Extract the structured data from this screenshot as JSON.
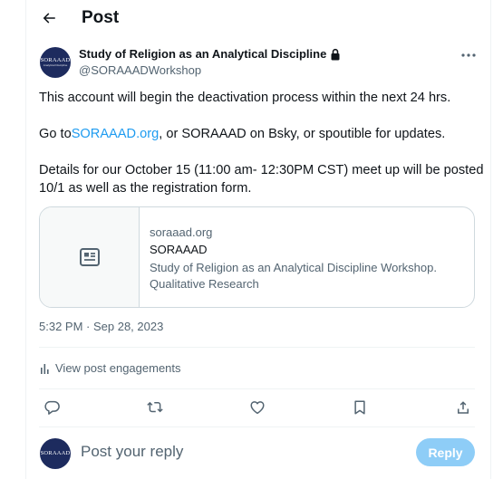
{
  "header": {
    "title": "Post"
  },
  "post": {
    "author_name": "Study of Religion as an Analytical Discipline",
    "author_handle": "@SORAAADWorkshop",
    "avatar_text": "SORAAAD",
    "avatar_subtext": "Analytical Discipline",
    "lines": {
      "line1": "This account will begin the deactivation process within the next 24 hrs.",
      "line2_prefix": "Go to",
      "line2_link": "SORAAAD.org",
      "line2_suffix": ", or SORAAAD on Bsky, or spoutible for updates.",
      "line3": "Details for our October 15 (11:00 am- 12:30PM CST) meet up will be posted",
      "line4": "10/1 as well as the registration form."
    },
    "card": {
      "domain": "soraaad.org",
      "title": "SORAAAD",
      "description": "Study of Religion as an Analytical Discipline Workshop. Qualitative Research"
    },
    "timestamp": "5:32 PM · Sep 28, 2023",
    "engagements_label": "View post engagements"
  },
  "reply": {
    "placeholder": "Post your reply",
    "button_label": "Reply",
    "avatar_text": "SORAAAD"
  },
  "icons": {
    "back": "arrow-left-icon",
    "lock": "lock-icon",
    "more": "more-dots-icon",
    "card": "article-icon",
    "analytics": "analytics-bars-icon",
    "reply": "comment-icon",
    "repost": "repost-icon",
    "like": "heart-icon",
    "bookmark": "bookmark-icon",
    "share": "share-icon"
  },
  "colors": {
    "accent": "#1d9bf0",
    "reply_button": "#8ecdf7",
    "secondary_text": "#536471",
    "avatar": "#1d2b5e"
  }
}
